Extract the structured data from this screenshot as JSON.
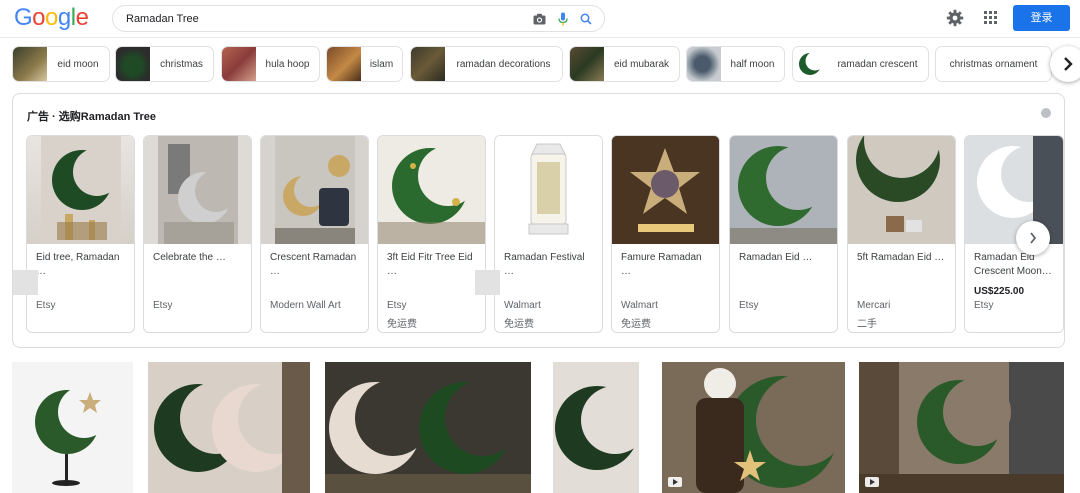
{
  "header": {
    "logo": [
      "G",
      "o",
      "o",
      "g",
      "l",
      "e"
    ],
    "logo_colors": [
      "#4285f4",
      "#ea4335",
      "#fbbc05",
      "#4285f4",
      "#34a853",
      "#ea4335"
    ],
    "search_value": "Ramadan Tree",
    "signin_label": "登录"
  },
  "chips": [
    {
      "label": "eid moon"
    },
    {
      "label": "christmas"
    },
    {
      "label": "hula hoop"
    },
    {
      "label": "islam"
    },
    {
      "label": "ramadan decorations"
    },
    {
      "label": "eid mubarak"
    },
    {
      "label": "half moon"
    },
    {
      "label": "ramadan crescent"
    },
    {
      "label": "christmas ornament"
    }
  ],
  "ads": {
    "title": "广告 · 选购Ramadan Tree",
    "products": [
      {
        "title": "Eid tree, Ramadan …",
        "price": "",
        "seller": "Etsy",
        "shipping": ""
      },
      {
        "title": "Celebrate the …",
        "price": "",
        "seller": "Etsy",
        "shipping": ""
      },
      {
        "title": "Crescent Ramadan …",
        "price": "",
        "seller": "Modern Wall Art",
        "shipping": ""
      },
      {
        "title": "3ft Eid Fitr Tree Eid …",
        "price": "",
        "seller": "Etsy",
        "shipping": "免运费"
      },
      {
        "title": "Ramadan Festival …",
        "price": "",
        "seller": "Walmart",
        "shipping": "免运费"
      },
      {
        "title": "Famure Ramadan …",
        "price": "",
        "seller": "Walmart",
        "shipping": "免运费"
      },
      {
        "title": "Ramadan Eid …",
        "price": "",
        "seller": "Etsy",
        "shipping": ""
      },
      {
        "title": "5ft Ramadan Eid …",
        "price": "",
        "seller": "Mercari",
        "shipping": "二手"
      },
      {
        "title": "Ramadan Eid Crescent Moon…",
        "price": "US$225.00",
        "seller": "Etsy",
        "shipping": ""
      }
    ]
  },
  "icons": {
    "camera": "camera-icon",
    "mic": "microphone-icon",
    "search": "search-icon",
    "settings": "gear-icon",
    "apps": "apps-grid-icon",
    "next": "chevron-right-icon",
    "info": "info-icon",
    "play": "play-icon"
  },
  "colors": {
    "brand_blue": "#1a73e8",
    "text": "#202124",
    "muted": "#5f6368"
  }
}
